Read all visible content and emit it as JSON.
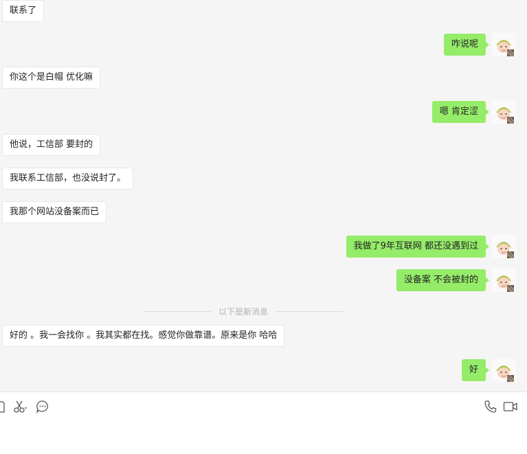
{
  "messages": [
    {
      "side": "left",
      "text": "联系了"
    },
    {
      "side": "right",
      "text": "咋说呢"
    },
    {
      "side": "left",
      "text": "你这个是白帽 优化嘛"
    },
    {
      "side": "right",
      "text": "嗯 肯定涩"
    },
    {
      "side": "left",
      "text": "他说，工信部 要封的"
    },
    {
      "side": "left",
      "text": "我联系工信部，也没说封了。"
    },
    {
      "side": "left",
      "text": "我那个网站没备案而已"
    },
    {
      "side": "right",
      "text": "我做了9年互联网 都还没遇到过"
    },
    {
      "side": "right",
      "text": "没备案 不会被封的"
    },
    {
      "side": "left",
      "text": "好的 。我一会找你 。我其实都在找。感觉你做靠谱。原来是你 哈哈"
    },
    {
      "side": "right",
      "text": "好"
    }
  ],
  "divider_text": "以下是新消息",
  "toolbar": {
    "left_icons": [
      "file-icon",
      "scissors-icon",
      "chat-bubble-icon"
    ],
    "right_icons": [
      "phone-icon",
      "video-call-icon"
    ]
  },
  "colors": {
    "background": "#f5f5f5",
    "self_bubble": "#95ec69",
    "other_bubble": "#ffffff",
    "divider_text": "#b2b2b2"
  }
}
